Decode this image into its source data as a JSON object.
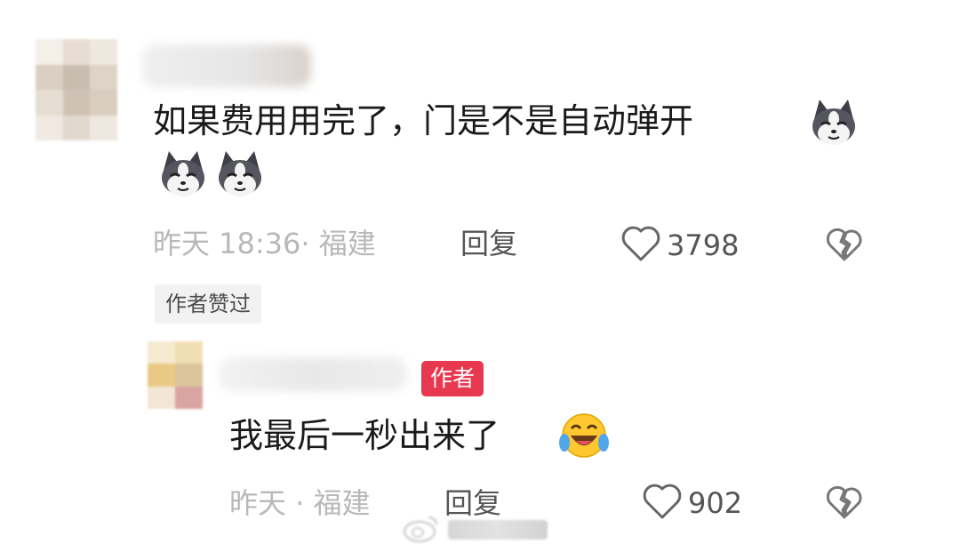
{
  "comment": {
    "text": "如果费用用完了，门是不是自动弹开",
    "time_location": "昨天 18:36· 福建",
    "reply_label": "回复",
    "like_count": "3798",
    "author_liked_label": "作者赞过"
  },
  "reply": {
    "author_badge": "作者",
    "text": "我最后一秒出来了",
    "time_location": "昨天 · 福建",
    "reply_label": "回复",
    "like_count": "902"
  },
  "icons": {
    "emoji": "husky-emoji-icon",
    "laugh": "laugh-cry-emoji-icon",
    "like": "heart-outline-icon",
    "dislike": "broken-heart-icon"
  },
  "colors": {
    "author_badge": "#e8384f",
    "meta_gray": "#b8b8b8",
    "text": "#1a1a1a"
  }
}
